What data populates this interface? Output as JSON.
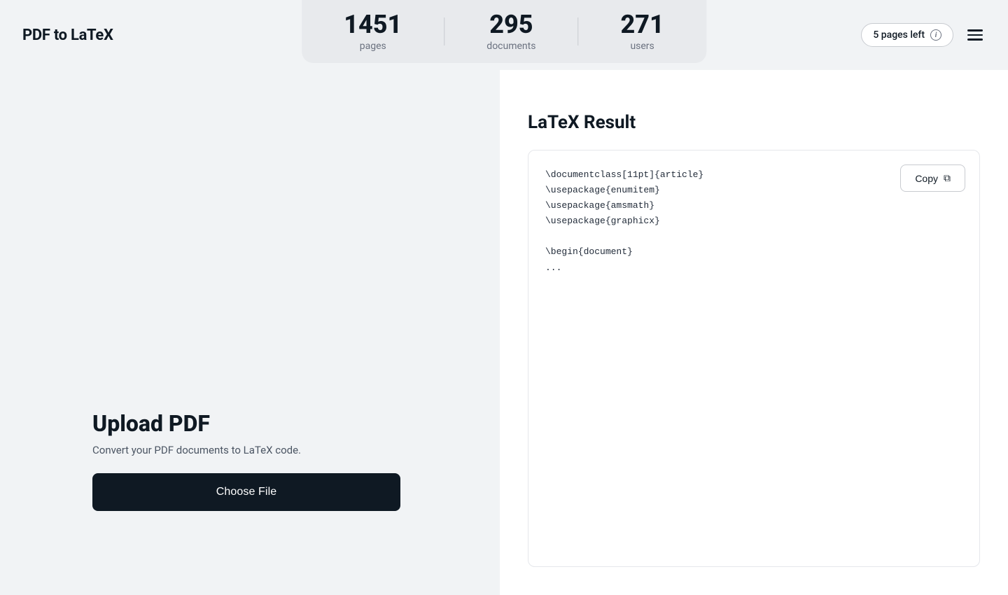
{
  "header": {
    "logo": "PDF to LaTeX",
    "pages_left_label": "5 pages left",
    "info_icon_char": "i"
  },
  "stats": {
    "items": [
      {
        "number": "1451",
        "label": "pages"
      },
      {
        "number": "295",
        "label": "documents"
      },
      {
        "number": "271",
        "label": "users"
      }
    ]
  },
  "left_panel": {
    "upload_title": "Upload PDF",
    "upload_subtitle": "Convert your PDF documents to LaTeX code.",
    "choose_file_label": "Choose File"
  },
  "right_panel": {
    "result_title": "LaTeX Result",
    "copy_label": "Copy",
    "latex_code": "\\documentclass[11pt]{article}\n\\usepackage{enumitem}\n\\usepackage{amsmath}\n\\usepackage{graphicx}\n\n\\begin{document}\n..."
  }
}
